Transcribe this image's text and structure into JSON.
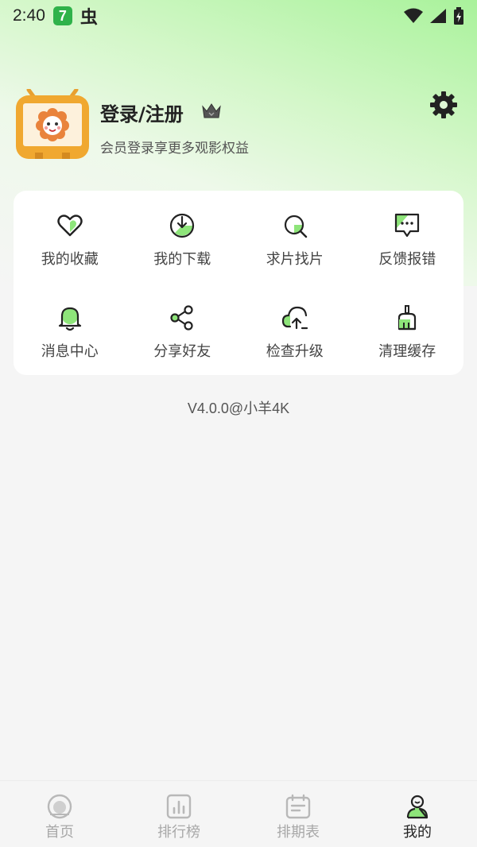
{
  "status_bar": {
    "time": "2:40",
    "app_badge": "7",
    "extra_glyph": "虫"
  },
  "profile": {
    "login_label": "登录/注册",
    "subtitle": "会员登录享更多观影权益"
  },
  "features": [
    {
      "label": "我的收藏",
      "icon": "heart-icon"
    },
    {
      "label": "我的下载",
      "icon": "download-icon"
    },
    {
      "label": "求片找片",
      "icon": "search-icon"
    },
    {
      "label": "反馈报错",
      "icon": "feedback-icon"
    },
    {
      "label": "消息中心",
      "icon": "bell-icon"
    },
    {
      "label": "分享好友",
      "icon": "share-icon"
    },
    {
      "label": "检查升级",
      "icon": "cloud-upload-icon"
    },
    {
      "label": "清理缓存",
      "icon": "broom-icon"
    }
  ],
  "version": "V4.0.0@小羊4K",
  "bottom_nav": [
    {
      "label": "首页",
      "icon": "home-icon",
      "active": false
    },
    {
      "label": "排行榜",
      "icon": "chart-icon",
      "active": false
    },
    {
      "label": "排期表",
      "icon": "calendar-icon",
      "active": false
    },
    {
      "label": "我的",
      "icon": "profile-icon",
      "active": true
    }
  ],
  "colors": {
    "accent": "#8ee57a",
    "dark": "#222222",
    "avatar_frame": "#f0a830"
  }
}
